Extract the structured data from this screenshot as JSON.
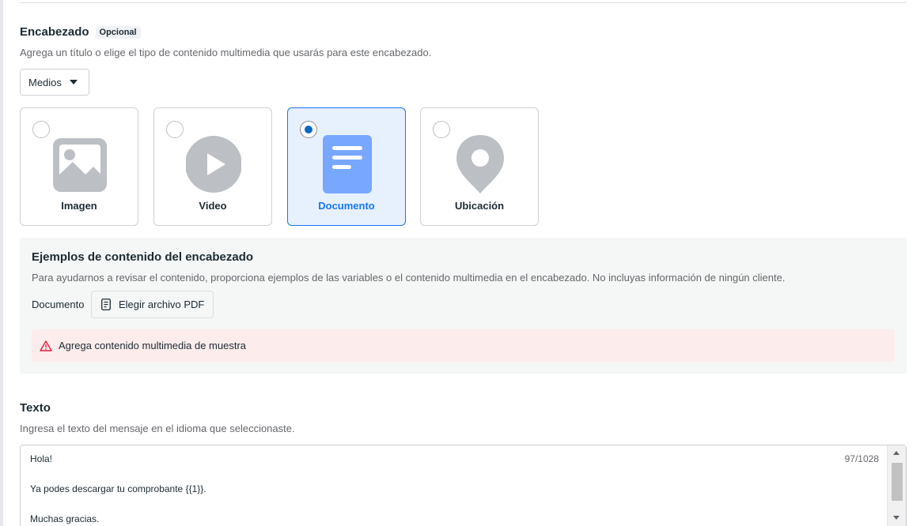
{
  "header": {
    "title": "Encabezado",
    "badge": "Opcional",
    "description": "Agrega un título o elige el tipo de contenido multimedia que usarás para este encabezado.",
    "dropdown_value": "Medios"
  },
  "media_options": [
    {
      "label": "Imagen",
      "icon": "image-icon",
      "selected": false
    },
    {
      "label": "Video",
      "icon": "play-icon",
      "selected": false
    },
    {
      "label": "Documento",
      "icon": "document-icon",
      "selected": true
    },
    {
      "label": "Ubicación",
      "icon": "location-pin-icon",
      "selected": false
    }
  ],
  "examples": {
    "title": "Ejemplos de contenido del encabezado",
    "description": "Para ayudarnos a revisar el contenido, proporciona ejemplos de las variables o el contenido multimedia en el encabezado. No incluyas información de ningún cliente.",
    "document_label": "Documento",
    "file_button": "Elegir archivo PDF",
    "alert": "Agrega contenido multimedia de muestra"
  },
  "body_text": {
    "title": "Texto",
    "description": "Ingresa el texto del mensaje en el idioma que seleccionaste.",
    "lines": [
      "Hola!",
      "Ya podes descargar tu comprobante {{1}}.",
      "Muchas gracias."
    ],
    "counter": "97/1028"
  },
  "colors": {
    "accent": "#1877f2",
    "selected_bg": "#e7f0fd",
    "icon_gray": "#bcc0c4",
    "document_icon": "#77a7ff",
    "alert_bg": "#fdecec",
    "alert_icon": "#e41e3f"
  }
}
